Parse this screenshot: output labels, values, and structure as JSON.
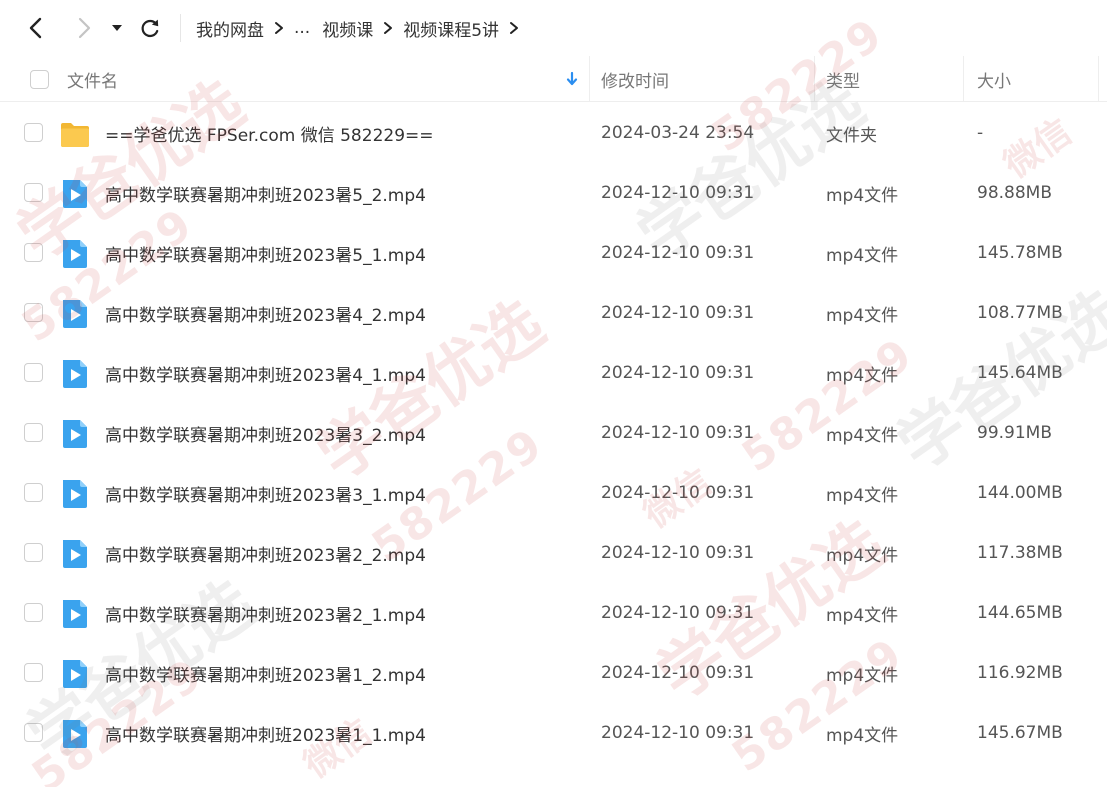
{
  "nav": {
    "breadcrumb": [
      "我的网盘",
      "...",
      "视频课",
      "视频课程5讲"
    ]
  },
  "columns": {
    "name": "文件名",
    "modified": "修改时间",
    "type": "类型",
    "size": "大小"
  },
  "files": [
    {
      "name": "==学爸优选 FPSer.com 微信 582229==",
      "modified": "2024-03-24 23:54",
      "type": "文件夹",
      "size": "-",
      "icon": "folder-icon"
    },
    {
      "name": "高中数学联赛暑期冲刺班2023暑5_2.mp4",
      "modified": "2024-12-10 09:31",
      "type": "mp4文件",
      "size": "98.88MB",
      "icon": "video-file-icon"
    },
    {
      "name": "高中数学联赛暑期冲刺班2023暑5_1.mp4",
      "modified": "2024-12-10 09:31",
      "type": "mp4文件",
      "size": "145.78MB",
      "icon": "video-file-icon"
    },
    {
      "name": "高中数学联赛暑期冲刺班2023暑4_2.mp4",
      "modified": "2024-12-10 09:31",
      "type": "mp4文件",
      "size": "108.77MB",
      "icon": "video-file-icon"
    },
    {
      "name": "高中数学联赛暑期冲刺班2023暑4_1.mp4",
      "modified": "2024-12-10 09:31",
      "type": "mp4文件",
      "size": "145.64MB",
      "icon": "video-file-icon"
    },
    {
      "name": "高中数学联赛暑期冲刺班2023暑3_2.mp4",
      "modified": "2024-12-10 09:31",
      "type": "mp4文件",
      "size": "99.91MB",
      "icon": "video-file-icon"
    },
    {
      "name": "高中数学联赛暑期冲刺班2023暑3_1.mp4",
      "modified": "2024-12-10 09:31",
      "type": "mp4文件",
      "size": "144.00MB",
      "icon": "video-file-icon"
    },
    {
      "name": "高中数学联赛暑期冲刺班2023暑2_2.mp4",
      "modified": "2024-12-10 09:31",
      "type": "mp4文件",
      "size": "117.38MB",
      "icon": "video-file-icon"
    },
    {
      "name": "高中数学联赛暑期冲刺班2023暑2_1.mp4",
      "modified": "2024-12-10 09:31",
      "type": "mp4文件",
      "size": "144.65MB",
      "icon": "video-file-icon"
    },
    {
      "name": "高中数学联赛暑期冲刺班2023暑1_2.mp4",
      "modified": "2024-12-10 09:31",
      "type": "mp4文件",
      "size": "116.92MB",
      "icon": "video-file-icon"
    },
    {
      "name": "高中数学联赛暑期冲刺班2023暑1_1.mp4",
      "modified": "2024-12-10 09:31",
      "type": "mp4文件",
      "size": "145.67MB",
      "icon": "video-file-icon"
    }
  ],
  "watermark": {
    "brand": "学爸优选",
    "wechat": "微信",
    "number": "582229"
  },
  "colors": {
    "folder": "#f7c14a",
    "video": "#3aa3ee",
    "sort_arrow": "#2b8ef0"
  }
}
